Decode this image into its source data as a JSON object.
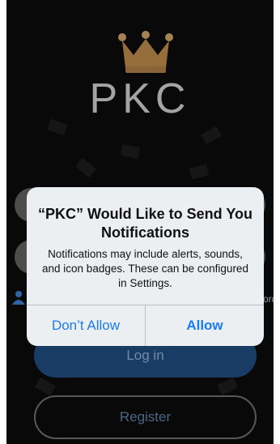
{
  "app": {
    "logo_text": "PKC"
  },
  "login": {
    "side_text": "ord",
    "login_label": "Log in",
    "register_label": "Register"
  },
  "alert": {
    "title": "“PKC” Would Like to Send You Notifications",
    "message": "Notifications may include alerts, sounds, and icon badges. These can be configured in Settings.",
    "deny_label": "Don’t Allow",
    "allow_label": "Allow"
  },
  "colors": {
    "accent": "#1a7cf0",
    "login_button": "#1e4a7b",
    "crown_gold": "#c8a064"
  },
  "icons": [
    "crown-icon",
    "user-icon"
  ]
}
